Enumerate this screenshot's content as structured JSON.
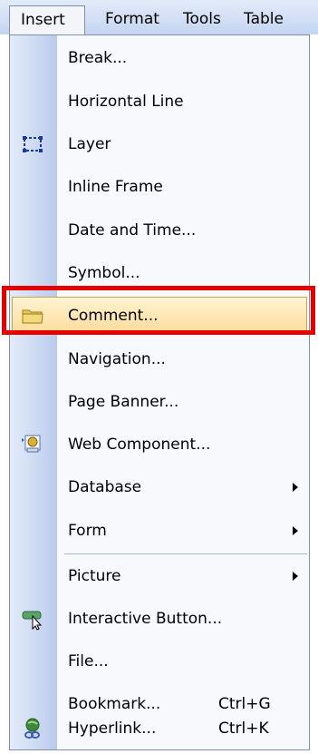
{
  "menubar": {
    "insert": "Insert",
    "format": "Format",
    "tools": "Tools",
    "table": "Table"
  },
  "menu": {
    "items": [
      {
        "label": "Break..."
      },
      {
        "label": "Horizontal Line"
      },
      {
        "label": "Layer",
        "icon": "layer-icon"
      },
      {
        "label": "Inline Frame"
      },
      {
        "label": "Date and Time..."
      },
      {
        "label": "Symbol..."
      },
      {
        "label": "Comment...",
        "icon": "folder-icon",
        "highlighted": true
      },
      {
        "label": "Navigation..."
      },
      {
        "label": "Page Banner..."
      },
      {
        "label": "Web Component...",
        "icon": "web-component-icon"
      },
      {
        "label": "Database",
        "submenu": true
      },
      {
        "label": "Form",
        "submenu": true
      },
      {
        "label": "Picture",
        "submenu": true
      },
      {
        "label": "Interactive Button...",
        "icon": "interactive-button-icon"
      },
      {
        "label": "File..."
      },
      {
        "label": "Bookmark...",
        "shortcut": "Ctrl+G"
      },
      {
        "label": "Hyperlink...",
        "shortcut": "Ctrl+K",
        "icon": "hyperlink-icon"
      }
    ]
  },
  "colors": {
    "highlight_border": "#e60000",
    "hover_fill": "#fbdb9a",
    "gutter": "#b9cbec"
  }
}
